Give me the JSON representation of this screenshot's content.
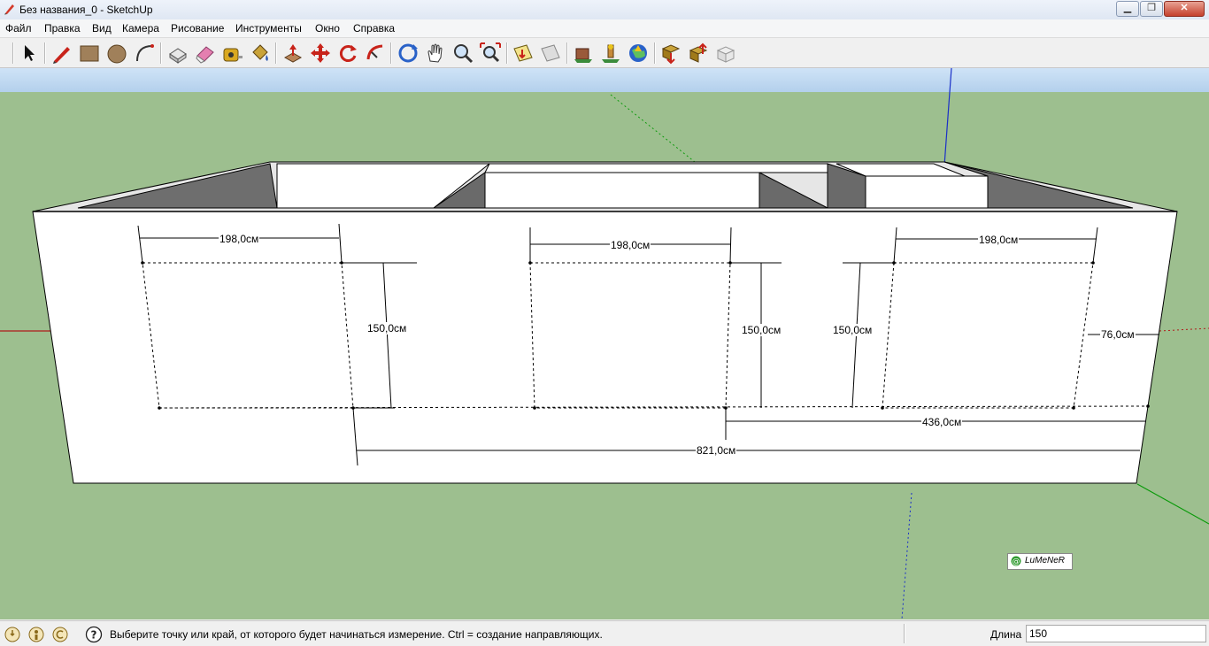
{
  "window": {
    "title": "Без названия_0 - SketchUp",
    "minimize": "▁",
    "maximize": "❐",
    "close": "✕"
  },
  "menu": {
    "items": [
      "Файл",
      "Правка",
      "Вид",
      "Камера",
      "Рисование",
      "Инструменты",
      "Окно",
      "Справка"
    ]
  },
  "toolbar": {
    "tools": [
      "select-tool",
      "pencil-tool",
      "rectangle-tool",
      "circle-tool",
      "arc-tool",
      "make-component-tool",
      "eraser-tool",
      "tape-measure-tool",
      "paint-bucket-tool",
      "push-pull-tool",
      "move-tool",
      "rotate-tool",
      "follow-me-tool",
      "orbit-tool",
      "pan-tool",
      "zoom-tool",
      "zoom-extents-tool",
      "add-location-tool",
      "toggle-terrain-tool",
      "get-models-tool",
      "share-model-tool",
      "google-earth-tool",
      "get-models-2-tool",
      "share-component-tool",
      "send-to-layout-tool"
    ]
  },
  "viewport": {
    "dimensions": {
      "top_left": "198,0см",
      "top_middle": "198,0см",
      "top_right": "198,0см",
      "height_left": "150,0см",
      "height_middle": "150,0см",
      "height_right": "150,0см",
      "height_edge": "76,0см",
      "width_partial": "436,0см",
      "width_total": "821,0см"
    },
    "logo": "LuMeNeR"
  },
  "status": {
    "message": "Выберите точку или край, от которого будет начинаться измерение.  Ctrl = создание направляющих.",
    "measure_label": "Длина",
    "measure_value": "150"
  },
  "colors": {
    "sky": "#b8d4ee",
    "ground": "#9dbf8f",
    "wall_face": "#ffffff",
    "wall_inner": "#6e6e6e",
    "axis_red": "#c00000",
    "axis_green": "#00a000",
    "axis_blue": "#0000c0"
  }
}
